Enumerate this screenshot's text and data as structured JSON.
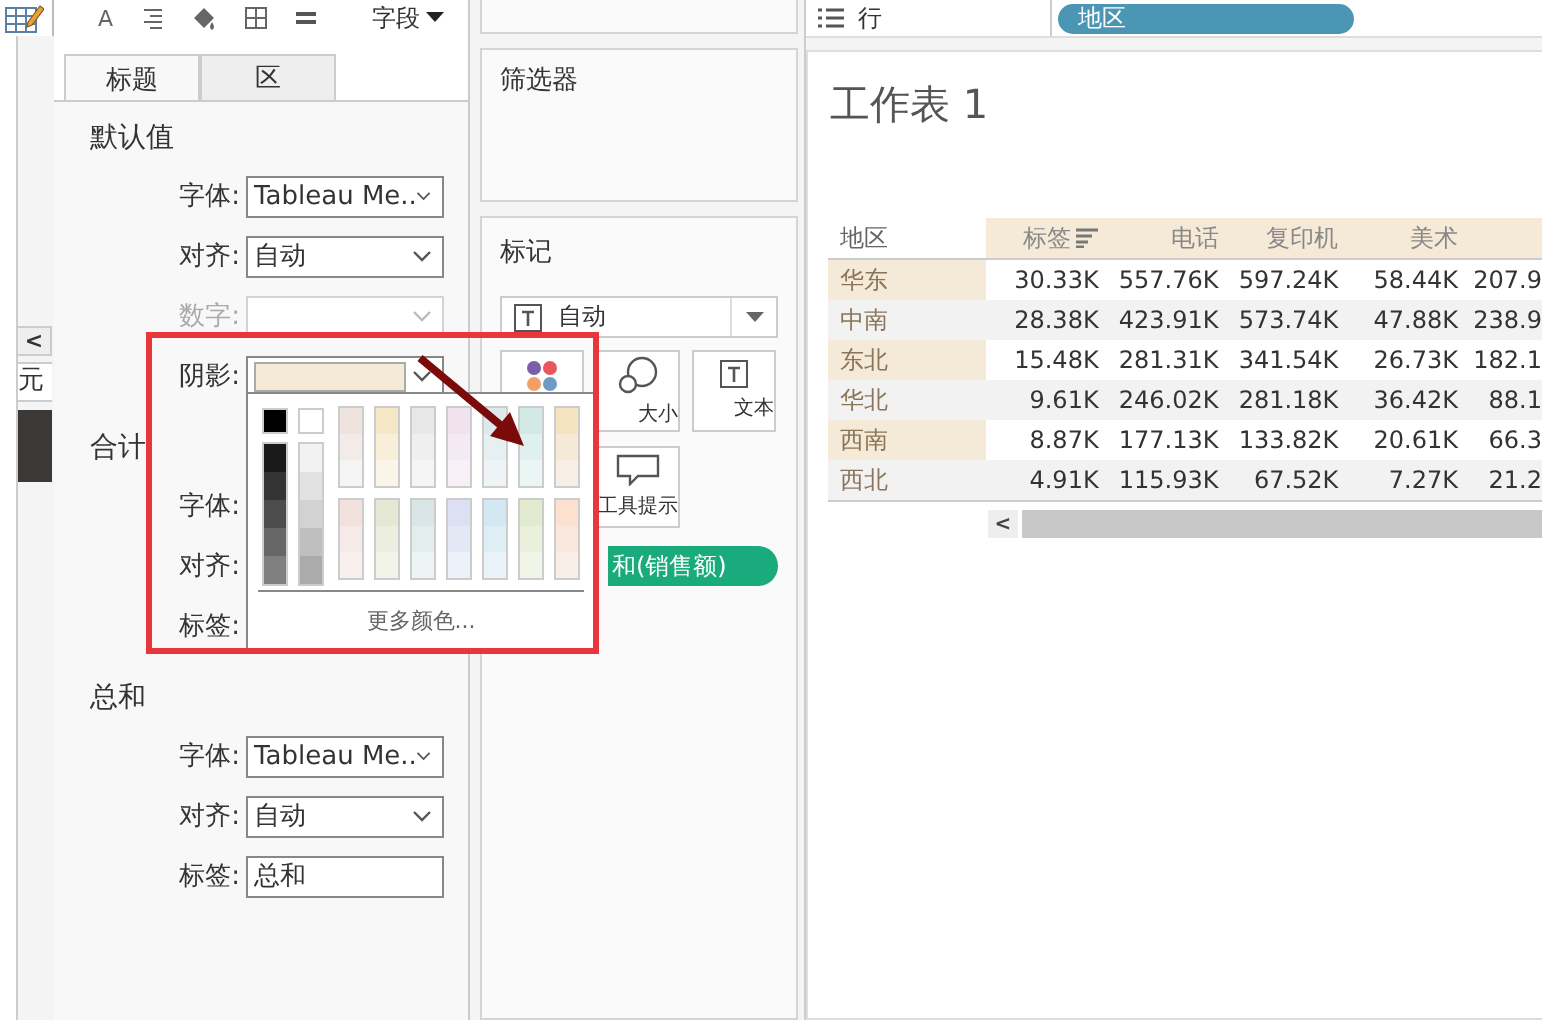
{
  "left_strip": {
    "collapse_button": "<",
    "cut_label": "元"
  },
  "format_pane": {
    "toolbar": {
      "font_icon": "A",
      "field_menu": "字段"
    },
    "tabs": [
      {
        "label": "标题",
        "selected": true
      },
      {
        "label": "区",
        "selected": false
      }
    ],
    "sections": [
      {
        "title": "默认值",
        "rows": [
          {
            "label": "字体:",
            "kind": "select",
            "value": "Tableau Me..",
            "disabled": false
          },
          {
            "label": "对齐:",
            "kind": "select",
            "value": "自动",
            "disabled": false
          },
          {
            "label": "数字:",
            "kind": "select",
            "disabled": true
          },
          {
            "label": "阴影:",
            "kind": "color",
            "color": "#f5e9d7",
            "disabled": false
          }
        ]
      },
      {
        "title": "合计",
        "rows": [
          {
            "label": "字体:",
            "kind": "covered",
            "disabled": false
          },
          {
            "label": "对齐:",
            "kind": "covered",
            "disabled": false
          },
          {
            "label": "标签:",
            "kind": "covered",
            "disabled": false
          }
        ]
      },
      {
        "title": "总和",
        "rows": [
          {
            "label": "字体:",
            "kind": "select",
            "value": "Tableau Me..",
            "disabled": false
          },
          {
            "label": "对齐:",
            "kind": "select",
            "value": "自动",
            "disabled": false
          },
          {
            "label": "标签:",
            "kind": "text",
            "value": "总和",
            "disabled": false
          }
        ]
      }
    ]
  },
  "cards": {
    "filters": {
      "title": "筛选器"
    },
    "marks": {
      "title": "标记",
      "mark_type": "自动",
      "buttons": [
        {
          "kind": "color"
        },
        {
          "kind": "size",
          "label": "大小"
        },
        {
          "kind": "text",
          "label": "文本"
        },
        {
          "kind": "tooltip",
          "label": "工具提示"
        }
      ],
      "pill": "和(销售额)"
    }
  },
  "sheet": {
    "rows_shelf": {
      "label": "行",
      "pill": "地区"
    },
    "title": "工作表 1",
    "table": {
      "row_header": "地区",
      "columns": [
        "标签",
        "电话",
        "复印机",
        "美术"
      ],
      "rows": [
        {
          "label": "华东",
          "cells": [
            "30.33K",
            "557.76K",
            "597.24K",
            "58.44K",
            "207.9"
          ]
        },
        {
          "label": "中南",
          "cells": [
            "28.38K",
            "423.91K",
            "573.74K",
            "47.88K",
            "238.9"
          ]
        },
        {
          "label": "东北",
          "cells": [
            "15.48K",
            "281.31K",
            "341.54K",
            "26.73K",
            "182.1"
          ]
        },
        {
          "label": "华北",
          "cells": [
            "9.61K",
            "246.02K",
            "281.18K",
            "36.42K",
            "88.1"
          ]
        },
        {
          "label": "西南",
          "cells": [
            "8.87K",
            "177.13K",
            "133.82K",
            "20.61K",
            "66.3"
          ]
        },
        {
          "label": "西北",
          "cells": [
            "4.91K",
            "115.93K",
            "67.52K",
            "7.27K",
            "21.2"
          ]
        }
      ]
    },
    "scroll_button": "<"
  },
  "color_popup": {
    "basic": [
      {
        "color": "#000000"
      },
      {
        "color": "#ffffff"
      }
    ],
    "gray_columns": [
      {
        "swatches": [
          {
            "color": "#1a1a1a"
          },
          {
            "color": "#333333"
          },
          {
            "color": "#4d4d4d"
          },
          {
            "color": "#666666"
          },
          {
            "color": "#808080"
          }
        ]
      },
      {
        "swatches": [
          {
            "color": "#f2f2f2"
          },
          {
            "color": "#e2e2e2"
          },
          {
            "color": "#d2d2d2"
          },
          {
            "color": "#bfbfbf"
          },
          {
            "color": "#ababab"
          }
        ]
      }
    ],
    "upper_columns": [
      {
        "swatches": [
          {
            "color": "#efe3df"
          },
          {
            "color": "#f3ebe8"
          },
          {
            "color": "#f5f5f5"
          }
        ]
      },
      {
        "swatches": [
          {
            "color": "#f5e7c5"
          },
          {
            "color": "#f7efd8"
          },
          {
            "color": "#faf5e8"
          }
        ]
      },
      {
        "swatches": [
          {
            "color": "#e8e8e8"
          },
          {
            "color": "#efefef"
          },
          {
            "color": "#f5f5f5"
          }
        ]
      },
      {
        "swatches": [
          {
            "color": "#f0e2ee"
          },
          {
            "color": "#f4eaf3"
          },
          {
            "color": "#f7f0f6"
          }
        ]
      },
      {
        "swatches": [
          {
            "color": "#dde9ec"
          },
          {
            "color": "#e6eff1"
          },
          {
            "color": "#eef4f6"
          }
        ]
      },
      {
        "swatches": [
          {
            "color": "#d3e9e6"
          },
          {
            "color": "#e0f0ee"
          },
          {
            "color": "#ebf5f4"
          }
        ]
      },
      {
        "swatches": [
          {
            "color": "#f6e4c0"
          },
          {
            "color": "#f5e9d7"
          },
          {
            "color": "#f7efe6"
          }
        ]
      }
    ],
    "lower_columns": [
      {
        "swatches": [
          {
            "color": "#f2e2de"
          },
          {
            "color": "#f5eae8"
          },
          {
            "color": "#f8f0ee"
          }
        ]
      },
      {
        "swatches": [
          {
            "color": "#e6e8d6"
          },
          {
            "color": "#eceee0"
          },
          {
            "color": "#f2f4ea"
          }
        ]
      },
      {
        "swatches": [
          {
            "color": "#d9e5e6"
          },
          {
            "color": "#e3edee"
          },
          {
            "color": "#ecf4f5"
          }
        ]
      },
      {
        "swatches": [
          {
            "color": "#dce0f2"
          },
          {
            "color": "#e4e8f5"
          },
          {
            "color": "#ecf0f8"
          }
        ]
      },
      {
        "swatches": [
          {
            "color": "#d3e8f2"
          },
          {
            "color": "#dfeef5"
          },
          {
            "color": "#eaf4f8"
          }
        ]
      },
      {
        "swatches": [
          {
            "color": "#e2ebcf"
          },
          {
            "color": "#eaf0dc"
          },
          {
            "color": "#f1f5e8"
          }
        ]
      },
      {
        "swatches": [
          {
            "color": "#fde0d0"
          },
          {
            "color": "#fae8de"
          },
          {
            "color": "#f8efe8"
          }
        ]
      }
    ],
    "more_colors": "更多颜色..."
  }
}
